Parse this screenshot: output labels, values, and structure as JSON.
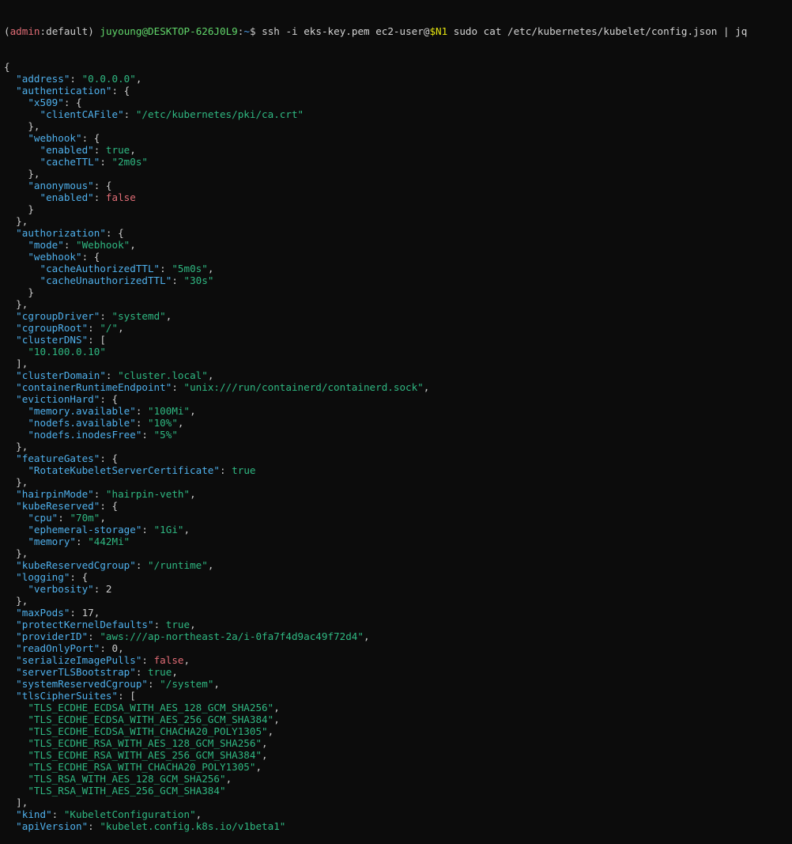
{
  "prompt": {
    "open_paren": "(",
    "context": "admin",
    "colon": ":",
    "namespace": "default",
    "close_paren": ")",
    "user_host": "juyoung@DESKTOP-626J0L9",
    "path_sep": ":",
    "path": "~",
    "dollar": "$",
    "command_part1": " ssh -i eks-key.pem ec2-user@",
    "variable": "$N1",
    "command_part2": " sudo cat /etc/kubernetes/kubelet/config.json | jq"
  },
  "colors": {
    "background": "#0c0c0c",
    "key": "#4fb0ec",
    "string": "#2fb882",
    "true": "#2fb882",
    "false": "#e06c75",
    "user_host": "#61d66a",
    "context": "#e06c75",
    "variable": "#e5e510"
  },
  "output_lines": [
    [
      {
        "t": "p",
        "v": "{"
      }
    ],
    [
      {
        "t": "i",
        "v": "  "
      },
      {
        "t": "k",
        "v": "\"address\""
      },
      {
        "t": "p",
        "v": ": "
      },
      {
        "t": "s",
        "v": "\"0.0.0.0\""
      },
      {
        "t": "p",
        "v": ","
      }
    ],
    [
      {
        "t": "i",
        "v": "  "
      },
      {
        "t": "k",
        "v": "\"authentication\""
      },
      {
        "t": "p",
        "v": ": {"
      }
    ],
    [
      {
        "t": "i",
        "v": "    "
      },
      {
        "t": "k",
        "v": "\"x509\""
      },
      {
        "t": "p",
        "v": ": {"
      }
    ],
    [
      {
        "t": "i",
        "v": "      "
      },
      {
        "t": "k",
        "v": "\"clientCAFile\""
      },
      {
        "t": "p",
        "v": ": "
      },
      {
        "t": "s",
        "v": "\"/etc/kubernetes/pki/ca.crt\""
      }
    ],
    [
      {
        "t": "i",
        "v": "    "
      },
      {
        "t": "p",
        "v": "},"
      }
    ],
    [
      {
        "t": "i",
        "v": "    "
      },
      {
        "t": "k",
        "v": "\"webhook\""
      },
      {
        "t": "p",
        "v": ": {"
      }
    ],
    [
      {
        "t": "i",
        "v": "      "
      },
      {
        "t": "k",
        "v": "\"enabled\""
      },
      {
        "t": "p",
        "v": ": "
      },
      {
        "t": "bt",
        "v": "true"
      },
      {
        "t": "p",
        "v": ","
      }
    ],
    [
      {
        "t": "i",
        "v": "      "
      },
      {
        "t": "k",
        "v": "\"cacheTTL\""
      },
      {
        "t": "p",
        "v": ": "
      },
      {
        "t": "s",
        "v": "\"2m0s\""
      }
    ],
    [
      {
        "t": "i",
        "v": "    "
      },
      {
        "t": "p",
        "v": "},"
      }
    ],
    [
      {
        "t": "i",
        "v": "    "
      },
      {
        "t": "k",
        "v": "\"anonymous\""
      },
      {
        "t": "p",
        "v": ": {"
      }
    ],
    [
      {
        "t": "i",
        "v": "      "
      },
      {
        "t": "k",
        "v": "\"enabled\""
      },
      {
        "t": "p",
        "v": ": "
      },
      {
        "t": "bf",
        "v": "false"
      }
    ],
    [
      {
        "t": "i",
        "v": "    "
      },
      {
        "t": "p",
        "v": "}"
      }
    ],
    [
      {
        "t": "i",
        "v": "  "
      },
      {
        "t": "p",
        "v": "},"
      }
    ],
    [
      {
        "t": "i",
        "v": "  "
      },
      {
        "t": "k",
        "v": "\"authorization\""
      },
      {
        "t": "p",
        "v": ": {"
      }
    ],
    [
      {
        "t": "i",
        "v": "    "
      },
      {
        "t": "k",
        "v": "\"mode\""
      },
      {
        "t": "p",
        "v": ": "
      },
      {
        "t": "s",
        "v": "\"Webhook\""
      },
      {
        "t": "p",
        "v": ","
      }
    ],
    [
      {
        "t": "i",
        "v": "    "
      },
      {
        "t": "k",
        "v": "\"webhook\""
      },
      {
        "t": "p",
        "v": ": {"
      }
    ],
    [
      {
        "t": "i",
        "v": "      "
      },
      {
        "t": "k",
        "v": "\"cacheAuthorizedTTL\""
      },
      {
        "t": "p",
        "v": ": "
      },
      {
        "t": "s",
        "v": "\"5m0s\""
      },
      {
        "t": "p",
        "v": ","
      }
    ],
    [
      {
        "t": "i",
        "v": "      "
      },
      {
        "t": "k",
        "v": "\"cacheUnauthorizedTTL\""
      },
      {
        "t": "p",
        "v": ": "
      },
      {
        "t": "s",
        "v": "\"30s\""
      }
    ],
    [
      {
        "t": "i",
        "v": "    "
      },
      {
        "t": "p",
        "v": "}"
      }
    ],
    [
      {
        "t": "i",
        "v": "  "
      },
      {
        "t": "p",
        "v": "},"
      }
    ],
    [
      {
        "t": "i",
        "v": "  "
      },
      {
        "t": "k",
        "v": "\"cgroupDriver\""
      },
      {
        "t": "p",
        "v": ": "
      },
      {
        "t": "s",
        "v": "\"systemd\""
      },
      {
        "t": "p",
        "v": ","
      }
    ],
    [
      {
        "t": "i",
        "v": "  "
      },
      {
        "t": "k",
        "v": "\"cgroupRoot\""
      },
      {
        "t": "p",
        "v": ": "
      },
      {
        "t": "s",
        "v": "\"/\""
      },
      {
        "t": "p",
        "v": ","
      }
    ],
    [
      {
        "t": "i",
        "v": "  "
      },
      {
        "t": "k",
        "v": "\"clusterDNS\""
      },
      {
        "t": "p",
        "v": ": ["
      }
    ],
    [
      {
        "t": "i",
        "v": "    "
      },
      {
        "t": "s",
        "v": "\"10.100.0.10\""
      }
    ],
    [
      {
        "t": "i",
        "v": "  "
      },
      {
        "t": "p",
        "v": "],"
      }
    ],
    [
      {
        "t": "i",
        "v": "  "
      },
      {
        "t": "k",
        "v": "\"clusterDomain\""
      },
      {
        "t": "p",
        "v": ": "
      },
      {
        "t": "s",
        "v": "\"cluster.local\""
      },
      {
        "t": "p",
        "v": ","
      }
    ],
    [
      {
        "t": "i",
        "v": "  "
      },
      {
        "t": "k",
        "v": "\"containerRuntimeEndpoint\""
      },
      {
        "t": "p",
        "v": ": "
      },
      {
        "t": "s",
        "v": "\"unix:///run/containerd/containerd.sock\""
      },
      {
        "t": "p",
        "v": ","
      }
    ],
    [
      {
        "t": "i",
        "v": "  "
      },
      {
        "t": "k",
        "v": "\"evictionHard\""
      },
      {
        "t": "p",
        "v": ": {"
      }
    ],
    [
      {
        "t": "i",
        "v": "    "
      },
      {
        "t": "k",
        "v": "\"memory.available\""
      },
      {
        "t": "p",
        "v": ": "
      },
      {
        "t": "s",
        "v": "\"100Mi\""
      },
      {
        "t": "p",
        "v": ","
      }
    ],
    [
      {
        "t": "i",
        "v": "    "
      },
      {
        "t": "k",
        "v": "\"nodefs.available\""
      },
      {
        "t": "p",
        "v": ": "
      },
      {
        "t": "s",
        "v": "\"10%\""
      },
      {
        "t": "p",
        "v": ","
      }
    ],
    [
      {
        "t": "i",
        "v": "    "
      },
      {
        "t": "k",
        "v": "\"nodefs.inodesFree\""
      },
      {
        "t": "p",
        "v": ": "
      },
      {
        "t": "s",
        "v": "\"5%\""
      }
    ],
    [
      {
        "t": "i",
        "v": "  "
      },
      {
        "t": "p",
        "v": "},"
      }
    ],
    [
      {
        "t": "i",
        "v": "  "
      },
      {
        "t": "k",
        "v": "\"featureGates\""
      },
      {
        "t": "p",
        "v": ": {"
      }
    ],
    [
      {
        "t": "i",
        "v": "    "
      },
      {
        "t": "k",
        "v": "\"RotateKubeletServerCertificate\""
      },
      {
        "t": "p",
        "v": ": "
      },
      {
        "t": "bt",
        "v": "true"
      }
    ],
    [
      {
        "t": "i",
        "v": "  "
      },
      {
        "t": "p",
        "v": "},"
      }
    ],
    [
      {
        "t": "i",
        "v": "  "
      },
      {
        "t": "k",
        "v": "\"hairpinMode\""
      },
      {
        "t": "p",
        "v": ": "
      },
      {
        "t": "s",
        "v": "\"hairpin-veth\""
      },
      {
        "t": "p",
        "v": ","
      }
    ],
    [
      {
        "t": "i",
        "v": "  "
      },
      {
        "t": "k",
        "v": "\"kubeReserved\""
      },
      {
        "t": "p",
        "v": ": {"
      }
    ],
    [
      {
        "t": "i",
        "v": "    "
      },
      {
        "t": "k",
        "v": "\"cpu\""
      },
      {
        "t": "p",
        "v": ": "
      },
      {
        "t": "s",
        "v": "\"70m\""
      },
      {
        "t": "p",
        "v": ","
      }
    ],
    [
      {
        "t": "i",
        "v": "    "
      },
      {
        "t": "k",
        "v": "\"ephemeral-storage\""
      },
      {
        "t": "p",
        "v": ": "
      },
      {
        "t": "s",
        "v": "\"1Gi\""
      },
      {
        "t": "p",
        "v": ","
      }
    ],
    [
      {
        "t": "i",
        "v": "    "
      },
      {
        "t": "k",
        "v": "\"memory\""
      },
      {
        "t": "p",
        "v": ": "
      },
      {
        "t": "s",
        "v": "\"442Mi\""
      }
    ],
    [
      {
        "t": "i",
        "v": "  "
      },
      {
        "t": "p",
        "v": "},"
      }
    ],
    [
      {
        "t": "i",
        "v": "  "
      },
      {
        "t": "k",
        "v": "\"kubeReservedCgroup\""
      },
      {
        "t": "p",
        "v": ": "
      },
      {
        "t": "s",
        "v": "\"/runtime\""
      },
      {
        "t": "p",
        "v": ","
      }
    ],
    [
      {
        "t": "i",
        "v": "  "
      },
      {
        "t": "k",
        "v": "\"logging\""
      },
      {
        "t": "p",
        "v": ": {"
      }
    ],
    [
      {
        "t": "i",
        "v": "    "
      },
      {
        "t": "k",
        "v": "\"verbosity\""
      },
      {
        "t": "p",
        "v": ": "
      },
      {
        "t": "n",
        "v": "2"
      }
    ],
    [
      {
        "t": "i",
        "v": "  "
      },
      {
        "t": "p",
        "v": "},"
      }
    ],
    [
      {
        "t": "i",
        "v": "  "
      },
      {
        "t": "k",
        "v": "\"maxPods\""
      },
      {
        "t": "p",
        "v": ": "
      },
      {
        "t": "n",
        "v": "17"
      },
      {
        "t": "p",
        "v": ","
      }
    ],
    [
      {
        "t": "i",
        "v": "  "
      },
      {
        "t": "k",
        "v": "\"protectKernelDefaults\""
      },
      {
        "t": "p",
        "v": ": "
      },
      {
        "t": "bt",
        "v": "true"
      },
      {
        "t": "p",
        "v": ","
      }
    ],
    [
      {
        "t": "i",
        "v": "  "
      },
      {
        "t": "k",
        "v": "\"providerID\""
      },
      {
        "t": "p",
        "v": ": "
      },
      {
        "t": "s",
        "v": "\"aws:///ap-northeast-2a/i-0fa7f4d9ac49f72d4\""
      },
      {
        "t": "p",
        "v": ","
      }
    ],
    [
      {
        "t": "i",
        "v": "  "
      },
      {
        "t": "k",
        "v": "\"readOnlyPort\""
      },
      {
        "t": "p",
        "v": ": "
      },
      {
        "t": "n",
        "v": "0"
      },
      {
        "t": "p",
        "v": ","
      }
    ],
    [
      {
        "t": "i",
        "v": "  "
      },
      {
        "t": "k",
        "v": "\"serializeImagePulls\""
      },
      {
        "t": "p",
        "v": ": "
      },
      {
        "t": "bf",
        "v": "false"
      },
      {
        "t": "p",
        "v": ","
      }
    ],
    [
      {
        "t": "i",
        "v": "  "
      },
      {
        "t": "k",
        "v": "\"serverTLSBootstrap\""
      },
      {
        "t": "p",
        "v": ": "
      },
      {
        "t": "bt",
        "v": "true"
      },
      {
        "t": "p",
        "v": ","
      }
    ],
    [
      {
        "t": "i",
        "v": "  "
      },
      {
        "t": "k",
        "v": "\"systemReservedCgroup\""
      },
      {
        "t": "p",
        "v": ": "
      },
      {
        "t": "s",
        "v": "\"/system\""
      },
      {
        "t": "p",
        "v": ","
      }
    ],
    [
      {
        "t": "i",
        "v": "  "
      },
      {
        "t": "k",
        "v": "\"tlsCipherSuites\""
      },
      {
        "t": "p",
        "v": ": ["
      }
    ],
    [
      {
        "t": "i",
        "v": "    "
      },
      {
        "t": "s",
        "v": "\"TLS_ECDHE_ECDSA_WITH_AES_128_GCM_SHA256\""
      },
      {
        "t": "p",
        "v": ","
      }
    ],
    [
      {
        "t": "i",
        "v": "    "
      },
      {
        "t": "s",
        "v": "\"TLS_ECDHE_ECDSA_WITH_AES_256_GCM_SHA384\""
      },
      {
        "t": "p",
        "v": ","
      }
    ],
    [
      {
        "t": "i",
        "v": "    "
      },
      {
        "t": "s",
        "v": "\"TLS_ECDHE_ECDSA_WITH_CHACHA20_POLY1305\""
      },
      {
        "t": "p",
        "v": ","
      }
    ],
    [
      {
        "t": "i",
        "v": "    "
      },
      {
        "t": "s",
        "v": "\"TLS_ECDHE_RSA_WITH_AES_128_GCM_SHA256\""
      },
      {
        "t": "p",
        "v": ","
      }
    ],
    [
      {
        "t": "i",
        "v": "    "
      },
      {
        "t": "s",
        "v": "\"TLS_ECDHE_RSA_WITH_AES_256_GCM_SHA384\""
      },
      {
        "t": "p",
        "v": ","
      }
    ],
    [
      {
        "t": "i",
        "v": "    "
      },
      {
        "t": "s",
        "v": "\"TLS_ECDHE_RSA_WITH_CHACHA20_POLY1305\""
      },
      {
        "t": "p",
        "v": ","
      }
    ],
    [
      {
        "t": "i",
        "v": "    "
      },
      {
        "t": "s",
        "v": "\"TLS_RSA_WITH_AES_128_GCM_SHA256\""
      },
      {
        "t": "p",
        "v": ","
      }
    ],
    [
      {
        "t": "i",
        "v": "    "
      },
      {
        "t": "s",
        "v": "\"TLS_RSA_WITH_AES_256_GCM_SHA384\""
      }
    ],
    [
      {
        "t": "i",
        "v": "  "
      },
      {
        "t": "p",
        "v": "],"
      }
    ],
    [
      {
        "t": "i",
        "v": "  "
      },
      {
        "t": "k",
        "v": "\"kind\""
      },
      {
        "t": "p",
        "v": ": "
      },
      {
        "t": "s",
        "v": "\"KubeletConfiguration\""
      },
      {
        "t": "p",
        "v": ","
      }
    ],
    [
      {
        "t": "i",
        "v": "  "
      },
      {
        "t": "k",
        "v": "\"apiVersion\""
      },
      {
        "t": "p",
        "v": ": "
      },
      {
        "t": "s",
        "v": "\"kubelet.config.k8s.io/v1beta1\""
      }
    ]
  ]
}
